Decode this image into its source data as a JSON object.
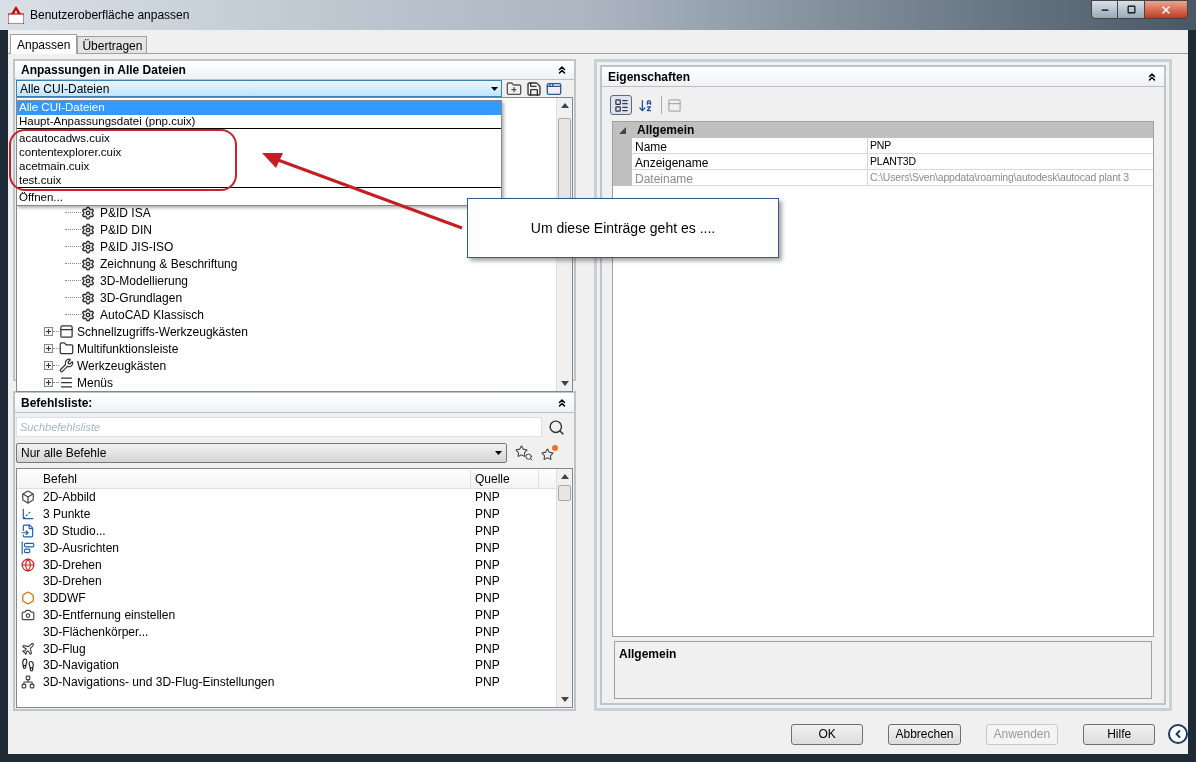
{
  "window": {
    "title": "Benutzeroberfläche anpassen"
  },
  "tabs": [
    {
      "label": "Anpassen",
      "selected": true
    },
    {
      "label": "Übertragen",
      "selected": false
    }
  ],
  "customizations": {
    "title": "Anpassungen in Alle Dateien",
    "file_select": {
      "value": "Alle CUI-Dateien",
      "expanded": true,
      "options": [
        {
          "label": "Alle CUI-Dateien",
          "selected": true,
          "separator_after": false
        },
        {
          "label": "Haupt-Anpassungsdatei (pnp.cuix)",
          "selected": false,
          "separator_after": true
        },
        {
          "label": "acautocadws.cuix",
          "selected": false,
          "separator_after": false
        },
        {
          "label": "contentexplorer.cuix",
          "selected": false,
          "separator_after": false
        },
        {
          "label": "acetmain.cuix",
          "selected": false,
          "separator_after": false
        },
        {
          "label": "test.cuix",
          "selected": false,
          "separator_after": true
        },
        {
          "label": "Öffnen...",
          "selected": false,
          "separator_after": false
        }
      ]
    },
    "tree": [
      {
        "kind": "workspace",
        "label": "P&ID ISA"
      },
      {
        "kind": "workspace",
        "label": "P&ID DIN"
      },
      {
        "kind": "workspace",
        "label": "P&ID JIS-ISO"
      },
      {
        "kind": "workspace",
        "label": "Zeichnung & Beschriftung"
      },
      {
        "kind": "workspace",
        "label": "3D-Modellierung"
      },
      {
        "kind": "workspace",
        "label": "3D-Grundlagen"
      },
      {
        "kind": "workspace",
        "label": "AutoCAD Klassisch"
      },
      {
        "kind": "group",
        "label": "Schnellzugriffs-Werkzeugkästen",
        "expanded": false
      },
      {
        "kind": "group",
        "label": "Multifunktionsleiste",
        "expanded": false
      },
      {
        "kind": "group",
        "label": "Werkzeugkästen",
        "expanded": false
      },
      {
        "kind": "group",
        "label": "Menüs",
        "expanded": false
      }
    ]
  },
  "callout": {
    "text": "Um diese Einträge geht es ...."
  },
  "command_list": {
    "title": "Befehlsliste:",
    "search": {
      "placeholder": "Suchbefehlsliste"
    },
    "filter": "Nur alle Befehle",
    "columns": [
      "Befehl",
      "Quelle"
    ],
    "rows": [
      {
        "command": "2D-Abbild",
        "source": "PNP"
      },
      {
        "command": "3 Punkte",
        "source": "PNP"
      },
      {
        "command": "3D Studio...",
        "source": "PNP"
      },
      {
        "command": "3D-Ausrichten",
        "source": "PNP"
      },
      {
        "command": "3D-Drehen",
        "source": "PNP"
      },
      {
        "command": "3D-Drehen",
        "source": "PNP"
      },
      {
        "command": "3DDWF",
        "source": "PNP"
      },
      {
        "command": "3D-Entfernung einstellen",
        "source": "PNP"
      },
      {
        "command": "3D-Flächenkörper...",
        "source": "PNP"
      },
      {
        "command": "3D-Flug",
        "source": "PNP"
      },
      {
        "command": "3D-Navigation",
        "source": "PNP"
      },
      {
        "command": "3D-Navigations- und 3D-Flug-Einstellungen",
        "source": "PNP"
      }
    ]
  },
  "properties": {
    "title": "Eigenschaften",
    "sort_modes": [
      {
        "kind": "categorized",
        "selected": true
      },
      {
        "kind": "alphabetical",
        "selected": false
      }
    ],
    "category": "Allgemein",
    "rows": [
      {
        "name": "Name",
        "value": "PNP",
        "disabled": false
      },
      {
        "name": "Anzeigename",
        "value": "PLANT3D",
        "disabled": false
      },
      {
        "name": "Dateiname",
        "value": "C:\\Users\\Sven\\appdata\\roaming\\autodesk\\autocad plant 3",
        "disabled": true
      }
    ],
    "description_title": "Allgemein"
  },
  "buttons": [
    {
      "label": "OK",
      "disabled": false
    },
    {
      "label": "Abbrechen",
      "disabled": false
    },
    {
      "label": "Anwenden",
      "disabled": true
    },
    {
      "label": "Hilfe",
      "disabled": false
    }
  ]
}
